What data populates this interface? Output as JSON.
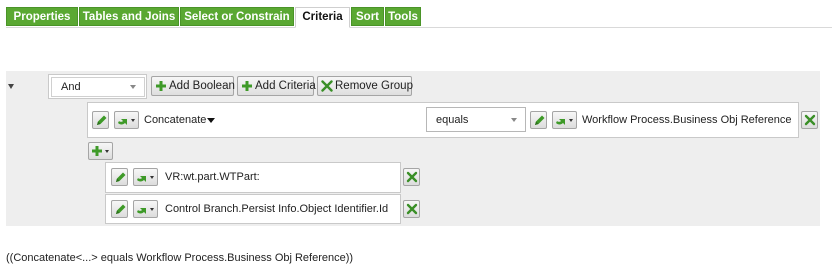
{
  "tabs": [
    {
      "label": "Properties",
      "active": false
    },
    {
      "label": "Tables and Joins",
      "active": false
    },
    {
      "label": "Select or Constrain",
      "active": false
    },
    {
      "label": "Criteria",
      "active": true
    },
    {
      "label": "Sort",
      "active": false
    },
    {
      "label": "Tools",
      "active": false
    }
  ],
  "colors": {
    "tab_green": "#5aa832",
    "panel_bg": "#eeeeee",
    "icon_green": "#3e9a28",
    "remove_green": "#3a8f27"
  },
  "group": {
    "operator": "And",
    "add_boolean_label": "Add Boolean",
    "add_criteria_label": "Add Criteria",
    "remove_group_label": "Remove Group"
  },
  "criterion": {
    "left_function": "Concatenate",
    "operator": "equals",
    "right_value": "Workflow Process.Business Obj Reference"
  },
  "arguments": [
    {
      "value": "VR:wt.part.WTPart:"
    },
    {
      "value": "Control Branch.Persist Info.Object Identifier.Id"
    }
  ],
  "summary": "((Concatenate<...> equals Workflow Process.Business Obj Reference))"
}
